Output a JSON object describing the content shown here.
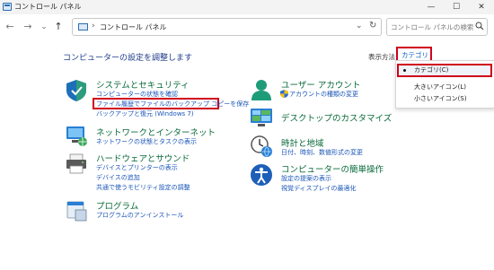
{
  "window": {
    "title": "コントロール パネル",
    "minimize_glyph": "—",
    "maximize_glyph": "☐",
    "close_glyph": "✕"
  },
  "nav": {
    "back_glyph": "←",
    "forward_glyph": "→",
    "recent_glyph": "⌄",
    "up_glyph": "↑",
    "address_sep": "›",
    "address_text": "コントロール パネル",
    "address_dropdown_glyph": "⌄",
    "refresh_glyph": "↻"
  },
  "search": {
    "placeholder": "コントロール パネルの検索"
  },
  "header": {
    "heading": "コンピューターの設定を調整します",
    "view_by_label": "表示方法:",
    "view_by_value": "カテゴリ ▾"
  },
  "view_menu": {
    "items": [
      "カテゴリ(C)",
      "大きいアイコン(L)",
      "小さいアイコン(S)"
    ]
  },
  "categories": {
    "security": {
      "title": "システムとセキュリティ",
      "links": [
        "コンピューターの状態を確認",
        "ファイル履歴でファイルのバックアップ コピーを保存",
        "バックアップと復元 (Windows 7)"
      ]
    },
    "network": {
      "title": "ネットワークとインターネット",
      "links": [
        "ネットワークの状態とタスクの表示"
      ]
    },
    "hardware": {
      "title": "ハードウェアとサウンド",
      "links": [
        "デバイスとプリンターの表示",
        "デバイスの追加",
        "共通で使うモビリティ設定の調整"
      ]
    },
    "programs": {
      "title": "プログラム",
      "links": [
        "プログラムのアンインストール"
      ]
    },
    "users": {
      "title": "ユーザー アカウント",
      "links": [
        "アカウントの種類の変更"
      ]
    },
    "appearance": {
      "title": "デスクトップのカスタマイズ"
    },
    "clock": {
      "title": "時計と地域",
      "links": [
        "日付、時刻、数値形式の変更"
      ]
    },
    "ease": {
      "title": "コンピューターの簡単操作",
      "links": [
        "設定の提案の表示",
        "視覚ディスプレイの最適化"
      ]
    }
  },
  "colors": {
    "highlight": "#d0021b",
    "category_title": "#0a6b3b",
    "link": "#1a55b8"
  }
}
